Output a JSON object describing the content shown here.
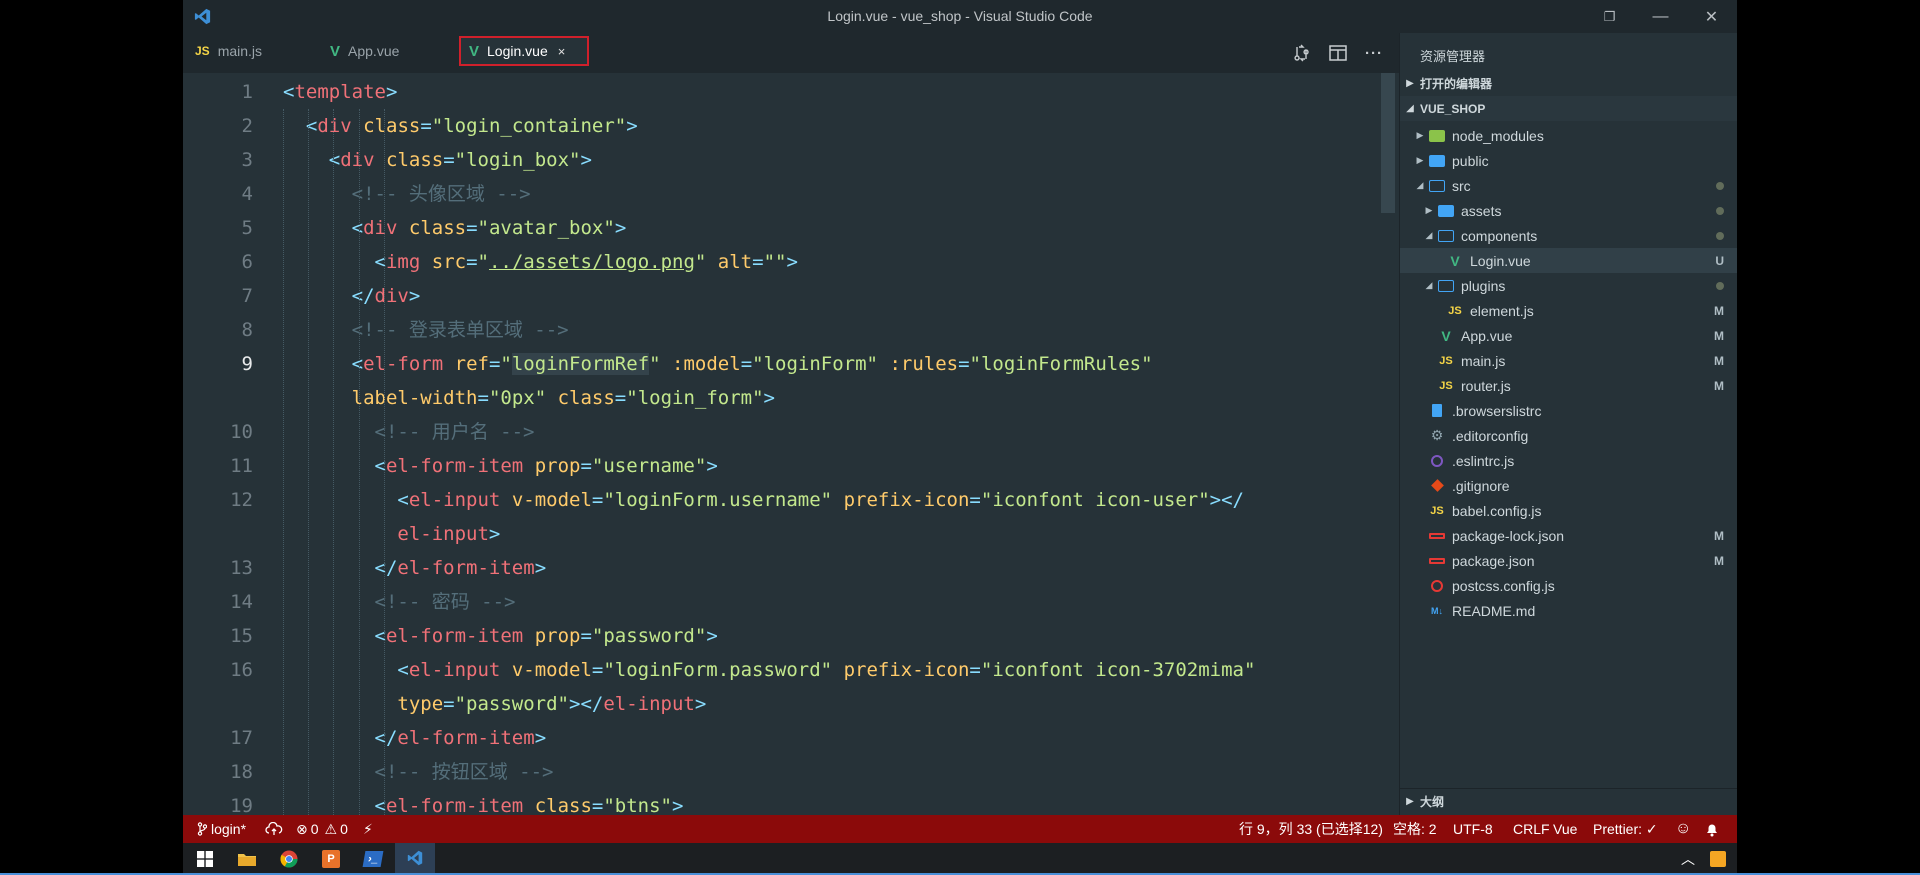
{
  "window": {
    "title": "Login.vue - vue_shop - Visual Studio Code",
    "controls": {
      "minimize": "—",
      "restore": "❐",
      "close": "✕"
    }
  },
  "tabs": [
    {
      "label": "main.js",
      "icon": "JS",
      "icon_color": "#f5d547"
    },
    {
      "label": "App.vue",
      "icon": "V",
      "icon_color": "#41b883"
    },
    {
      "label": "Login.vue",
      "icon": "V",
      "icon_color": "#41b883",
      "active": true,
      "close": "×"
    }
  ],
  "editor_actions": {
    "more": "···"
  },
  "editor": {
    "lines": [
      {
        "n": "1",
        "tokens": [
          [
            "p",
            "<"
          ],
          [
            "t",
            "template"
          ],
          [
            "p",
            ">"
          ]
        ]
      },
      {
        "n": "2",
        "tokens": [
          [
            "x",
            "  "
          ],
          [
            "p",
            "<"
          ],
          [
            "t",
            "div"
          ],
          [
            "x",
            " "
          ],
          [
            "a",
            "class"
          ],
          [
            "p",
            "="
          ],
          [
            "s",
            "\"login_container\""
          ],
          [
            "p",
            ">"
          ]
        ]
      },
      {
        "n": "3",
        "tokens": [
          [
            "x",
            "    "
          ],
          [
            "p",
            "<"
          ],
          [
            "t",
            "div"
          ],
          [
            "x",
            " "
          ],
          [
            "a",
            "class"
          ],
          [
            "p",
            "="
          ],
          [
            "s",
            "\"login_box\""
          ],
          [
            "p",
            ">"
          ]
        ]
      },
      {
        "n": "4",
        "tokens": [
          [
            "x",
            "      "
          ],
          [
            "c",
            "<!-- 头像区域 -->"
          ]
        ]
      },
      {
        "n": "5",
        "tokens": [
          [
            "x",
            "      "
          ],
          [
            "p",
            "<"
          ],
          [
            "t",
            "div"
          ],
          [
            "x",
            " "
          ],
          [
            "a",
            "class"
          ],
          [
            "p",
            "="
          ],
          [
            "s",
            "\"avatar_box\""
          ],
          [
            "p",
            ">"
          ]
        ]
      },
      {
        "n": "6",
        "tokens": [
          [
            "x",
            "        "
          ],
          [
            "p",
            "<"
          ],
          [
            "t",
            "img"
          ],
          [
            "x",
            " "
          ],
          [
            "a",
            "src"
          ],
          [
            "p",
            "="
          ],
          [
            "s",
            "\""
          ],
          [
            "su",
            "../assets/logo.png"
          ],
          [
            "s",
            "\""
          ],
          [
            "x",
            " "
          ],
          [
            "a",
            "alt"
          ],
          [
            "p",
            "="
          ],
          [
            "s",
            "\"\""
          ],
          [
            "p",
            ">"
          ]
        ]
      },
      {
        "n": "7",
        "tokens": [
          [
            "x",
            "      "
          ],
          [
            "p",
            "</"
          ],
          [
            "t",
            "div"
          ],
          [
            "p",
            ">"
          ]
        ]
      },
      {
        "n": "8",
        "tokens": [
          [
            "x",
            "      "
          ],
          [
            "c",
            "<!-- 登录表单区域 -->"
          ]
        ]
      },
      {
        "n": "9",
        "current": true,
        "tokens": [
          [
            "x",
            "      "
          ],
          [
            "p",
            "<"
          ],
          [
            "t",
            "el-form"
          ],
          [
            "x",
            " "
          ],
          [
            "a",
            "ref"
          ],
          [
            "p",
            "="
          ],
          [
            "s",
            "\""
          ],
          [
            "sh",
            "loginFormRef"
          ],
          [
            "s",
            "\""
          ],
          [
            "x",
            " "
          ],
          [
            "a",
            ":model"
          ],
          [
            "p",
            "="
          ],
          [
            "s",
            "\"loginForm\""
          ],
          [
            "x",
            " "
          ],
          [
            "a",
            ":rules"
          ],
          [
            "p",
            "="
          ],
          [
            "s",
            "\"loginFormRules\""
          ]
        ]
      },
      {
        "n": "",
        "tokens": [
          [
            "x",
            "      "
          ],
          [
            "a",
            "label-width"
          ],
          [
            "p",
            "="
          ],
          [
            "s",
            "\"0px\""
          ],
          [
            "x",
            " "
          ],
          [
            "a",
            "class"
          ],
          [
            "p",
            "="
          ],
          [
            "s",
            "\"login_form\""
          ],
          [
            "p",
            ">"
          ]
        ]
      },
      {
        "n": "10",
        "tokens": [
          [
            "x",
            "        "
          ],
          [
            "c",
            "<!-- 用户名 -->"
          ]
        ]
      },
      {
        "n": "11",
        "tokens": [
          [
            "x",
            "        "
          ],
          [
            "p",
            "<"
          ],
          [
            "t",
            "el-form-item"
          ],
          [
            "x",
            " "
          ],
          [
            "a",
            "prop"
          ],
          [
            "p",
            "="
          ],
          [
            "s",
            "\"username\""
          ],
          [
            "p",
            ">"
          ]
        ]
      },
      {
        "n": "12",
        "tokens": [
          [
            "x",
            "          "
          ],
          [
            "p",
            "<"
          ],
          [
            "t",
            "el-input"
          ],
          [
            "x",
            " "
          ],
          [
            "a",
            "v-model"
          ],
          [
            "p",
            "="
          ],
          [
            "s",
            "\"loginForm.username\""
          ],
          [
            "x",
            " "
          ],
          [
            "a",
            "prefix-icon"
          ],
          [
            "p",
            "="
          ],
          [
            "s",
            "\"iconfont icon-user\""
          ],
          [
            "p",
            "></"
          ]
        ]
      },
      {
        "n": "",
        "tokens": [
          [
            "x",
            "          "
          ],
          [
            "t",
            "el-input"
          ],
          [
            "p",
            ">"
          ]
        ]
      },
      {
        "n": "13",
        "tokens": [
          [
            "x",
            "        "
          ],
          [
            "p",
            "</"
          ],
          [
            "t",
            "el-form-item"
          ],
          [
            "p",
            ">"
          ]
        ]
      },
      {
        "n": "14",
        "tokens": [
          [
            "x",
            "        "
          ],
          [
            "c",
            "<!-- 密码 -->"
          ]
        ]
      },
      {
        "n": "15",
        "tokens": [
          [
            "x",
            "        "
          ],
          [
            "p",
            "<"
          ],
          [
            "t",
            "el-form-item"
          ],
          [
            "x",
            " "
          ],
          [
            "a",
            "prop"
          ],
          [
            "p",
            "="
          ],
          [
            "s",
            "\"password\""
          ],
          [
            "p",
            ">"
          ]
        ]
      },
      {
        "n": "16",
        "tokens": [
          [
            "x",
            "          "
          ],
          [
            "p",
            "<"
          ],
          [
            "t",
            "el-input"
          ],
          [
            "x",
            " "
          ],
          [
            "a",
            "v-model"
          ],
          [
            "p",
            "="
          ],
          [
            "s",
            "\"loginForm.password\""
          ],
          [
            "x",
            " "
          ],
          [
            "a",
            "prefix-icon"
          ],
          [
            "p",
            "="
          ],
          [
            "s",
            "\"iconfont icon-3702mima\""
          ]
        ]
      },
      {
        "n": "",
        "tokens": [
          [
            "x",
            "          "
          ],
          [
            "a",
            "type"
          ],
          [
            "p",
            "="
          ],
          [
            "s",
            "\"password\""
          ],
          [
            "p",
            "></"
          ],
          [
            "t",
            "el-input"
          ],
          [
            "p",
            ">"
          ]
        ]
      },
      {
        "n": "17",
        "tokens": [
          [
            "x",
            "        "
          ],
          [
            "p",
            "</"
          ],
          [
            "t",
            "el-form-item"
          ],
          [
            "p",
            ">"
          ]
        ]
      },
      {
        "n": "18",
        "tokens": [
          [
            "x",
            "        "
          ],
          [
            "c",
            "<!-- 按钮区域 -->"
          ]
        ]
      },
      {
        "n": "19",
        "tokens": [
          [
            "x",
            "        "
          ],
          [
            "p",
            "<"
          ],
          [
            "t",
            "el-form-item"
          ],
          [
            "x",
            " "
          ],
          [
            "a",
            "class"
          ],
          [
            "p",
            "="
          ],
          [
            "s",
            "\"btns\""
          ],
          [
            "p",
            ">"
          ]
        ]
      }
    ]
  },
  "explorer": {
    "title": "资源管理器",
    "open_editors": "打开的编辑器",
    "project": "VUE_SHOP",
    "outline": "大纲",
    "items": [
      {
        "label": "node_modules",
        "depth": 0,
        "caret": "▶",
        "icon": "folder-lib",
        "color": "#8bc34a"
      },
      {
        "label": "public",
        "depth": 0,
        "caret": "▶",
        "icon": "folder",
        "color": "#42a5f5"
      },
      {
        "label": "src",
        "depth": 0,
        "caret": "◢",
        "icon": "folder-open",
        "color": "#42a5f5",
        "dot": true
      },
      {
        "label": "assets",
        "depth": 1,
        "caret": "▶",
        "icon": "folder",
        "color": "#42a5f5",
        "dot": true
      },
      {
        "label": "components",
        "depth": 1,
        "caret": "◢",
        "icon": "folder-open",
        "color": "#42a5f5",
        "dot": true
      },
      {
        "label": "Login.vue",
        "depth": 2,
        "caret": "",
        "icon": "V",
        "color": "#41b883",
        "badge": "U",
        "selected": true
      },
      {
        "label": "plugins",
        "depth": 1,
        "caret": "◢",
        "icon": "folder-open",
        "color": "#42a5f5",
        "dot": true
      },
      {
        "label": "element.js",
        "depth": 2,
        "caret": "",
        "icon": "JS",
        "color": "#f5d547",
        "badge": "M"
      },
      {
        "label": "App.vue",
        "depth": 1,
        "caret": "",
        "icon": "V",
        "color": "#41b883",
        "badge": "M"
      },
      {
        "label": "main.js",
        "depth": 1,
        "caret": "",
        "icon": "JS",
        "color": "#f5d547",
        "badge": "M"
      },
      {
        "label": "router.js",
        "depth": 1,
        "caret": "",
        "icon": "JS",
        "color": "#f5d547",
        "badge": "M"
      },
      {
        "label": ".browserslistrc",
        "depth": 0,
        "caret": "",
        "icon": "file",
        "color": "#42a5f5"
      },
      {
        "label": ".editorconfig",
        "depth": 0,
        "caret": "",
        "icon": "gear",
        "color": "#90a4ae"
      },
      {
        "label": ".eslintrc.js",
        "depth": 0,
        "caret": "",
        "icon": "ring",
        "color": "#7e57c2"
      },
      {
        "label": ".gitignore",
        "depth": 0,
        "caret": "",
        "icon": "git",
        "color": "#e64a19"
      },
      {
        "label": "babel.config.js",
        "depth": 0,
        "caret": "",
        "icon": "JS",
        "color": "#f5d547"
      },
      {
        "label": "package-lock.json",
        "depth": 0,
        "caret": "",
        "icon": "npm",
        "color": "#e53935",
        "badge": "M"
      },
      {
        "label": "package.json",
        "depth": 0,
        "caret": "",
        "icon": "npm",
        "color": "#e53935",
        "badge": "M"
      },
      {
        "label": "postcss.config.js",
        "depth": 0,
        "caret": "",
        "icon": "postcss",
        "color": "#e53935"
      },
      {
        "label": "README.md",
        "depth": 0,
        "caret": "",
        "icon": "M↓",
        "color": "#42a5f5"
      }
    ]
  },
  "statusbar": {
    "branch": "login*",
    "errors": "0",
    "warnings": "0",
    "cursor": "行 9，列 33 (已选择12)",
    "spaces": "空格: 2",
    "encoding": "UTF-8",
    "eol": "CRLF",
    "language": "Vue",
    "prettier": "Prettier: ✓"
  },
  "colors": {
    "status_bg": "#8b0a0a",
    "editor_bg": "#263238",
    "active_tab_border": "#d0202b"
  }
}
